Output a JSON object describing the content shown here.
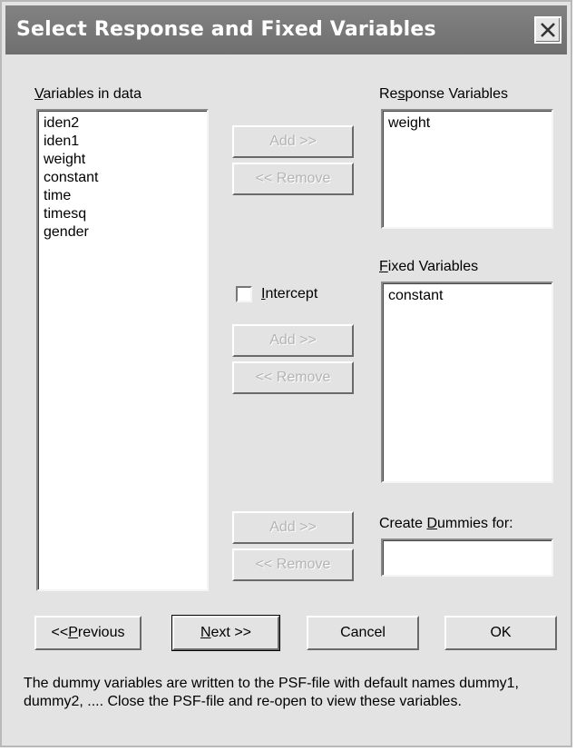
{
  "window": {
    "title": "Select Response and Fixed Variables"
  },
  "variables_panel": {
    "label_prefix": "",
    "label_mnemonic": "V",
    "label_rest": "ariables in data",
    "items": [
      "iden2",
      "iden1",
      "weight",
      "constant",
      "time",
      "timesq",
      "gender"
    ]
  },
  "response_panel": {
    "label_a": "Re",
    "label_mnemonic": "s",
    "label_b": "ponse Variables",
    "items": [
      "weight"
    ],
    "add_label": "Add >>",
    "remove_label": "<< Remove"
  },
  "fixed_panel": {
    "label_mnemonic": "F",
    "label_rest": "ixed Variables",
    "items": [
      "constant"
    ],
    "intercept_mnemonic": "I",
    "intercept_rest": "ntercept",
    "add_label": "Add >>",
    "remove_label": "<< Remove"
  },
  "dummies_panel": {
    "label_a": "Create ",
    "label_mnemonic": "D",
    "label_b": "ummies for:",
    "add_label": "Add >>",
    "remove_label": "<< Remove"
  },
  "footer": {
    "previous_a": "<< ",
    "previous_mnemonic": "P",
    "previous_b": "revious",
    "next_mnemonic": "N",
    "next_b": "ext >>",
    "cancel_label": "Cancel",
    "ok_label": "OK",
    "note": "The dummy variables are written to the PSF-file with default names dummy1, dummy2, .... Close the PSF-file and re-open to view these variables."
  }
}
